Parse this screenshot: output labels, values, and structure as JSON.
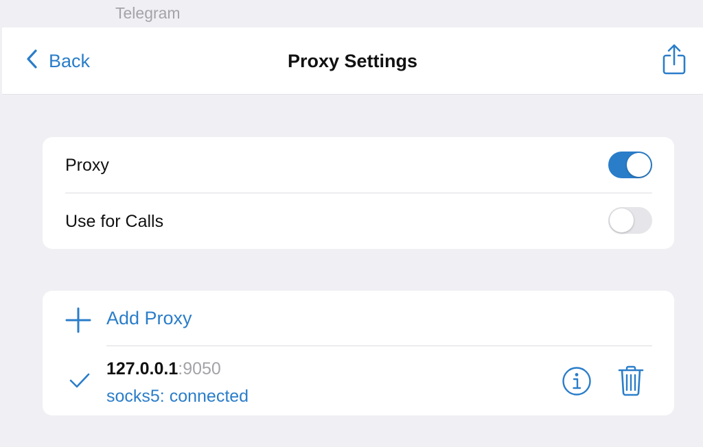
{
  "window": {
    "app_title": "Telegram"
  },
  "navbar": {
    "back_label": "Back",
    "title": "Proxy Settings"
  },
  "settings": {
    "proxy": {
      "label": "Proxy",
      "enabled": true
    },
    "use_for_calls": {
      "label": "Use for Calls",
      "enabled": false
    }
  },
  "proxies": {
    "add_label": "Add Proxy",
    "items": [
      {
        "host": "127.0.0.1",
        "separator": ":",
        "port": "9050",
        "status": "socks5: connected",
        "selected": true
      }
    ]
  },
  "colors": {
    "accent": "#2a7dc9",
    "background": "#efeff4",
    "muted": "#a3a3a8"
  },
  "icons": [
    "chevron-left-icon",
    "share-icon",
    "plus-icon",
    "checkmark-icon",
    "info-icon",
    "trash-icon"
  ]
}
